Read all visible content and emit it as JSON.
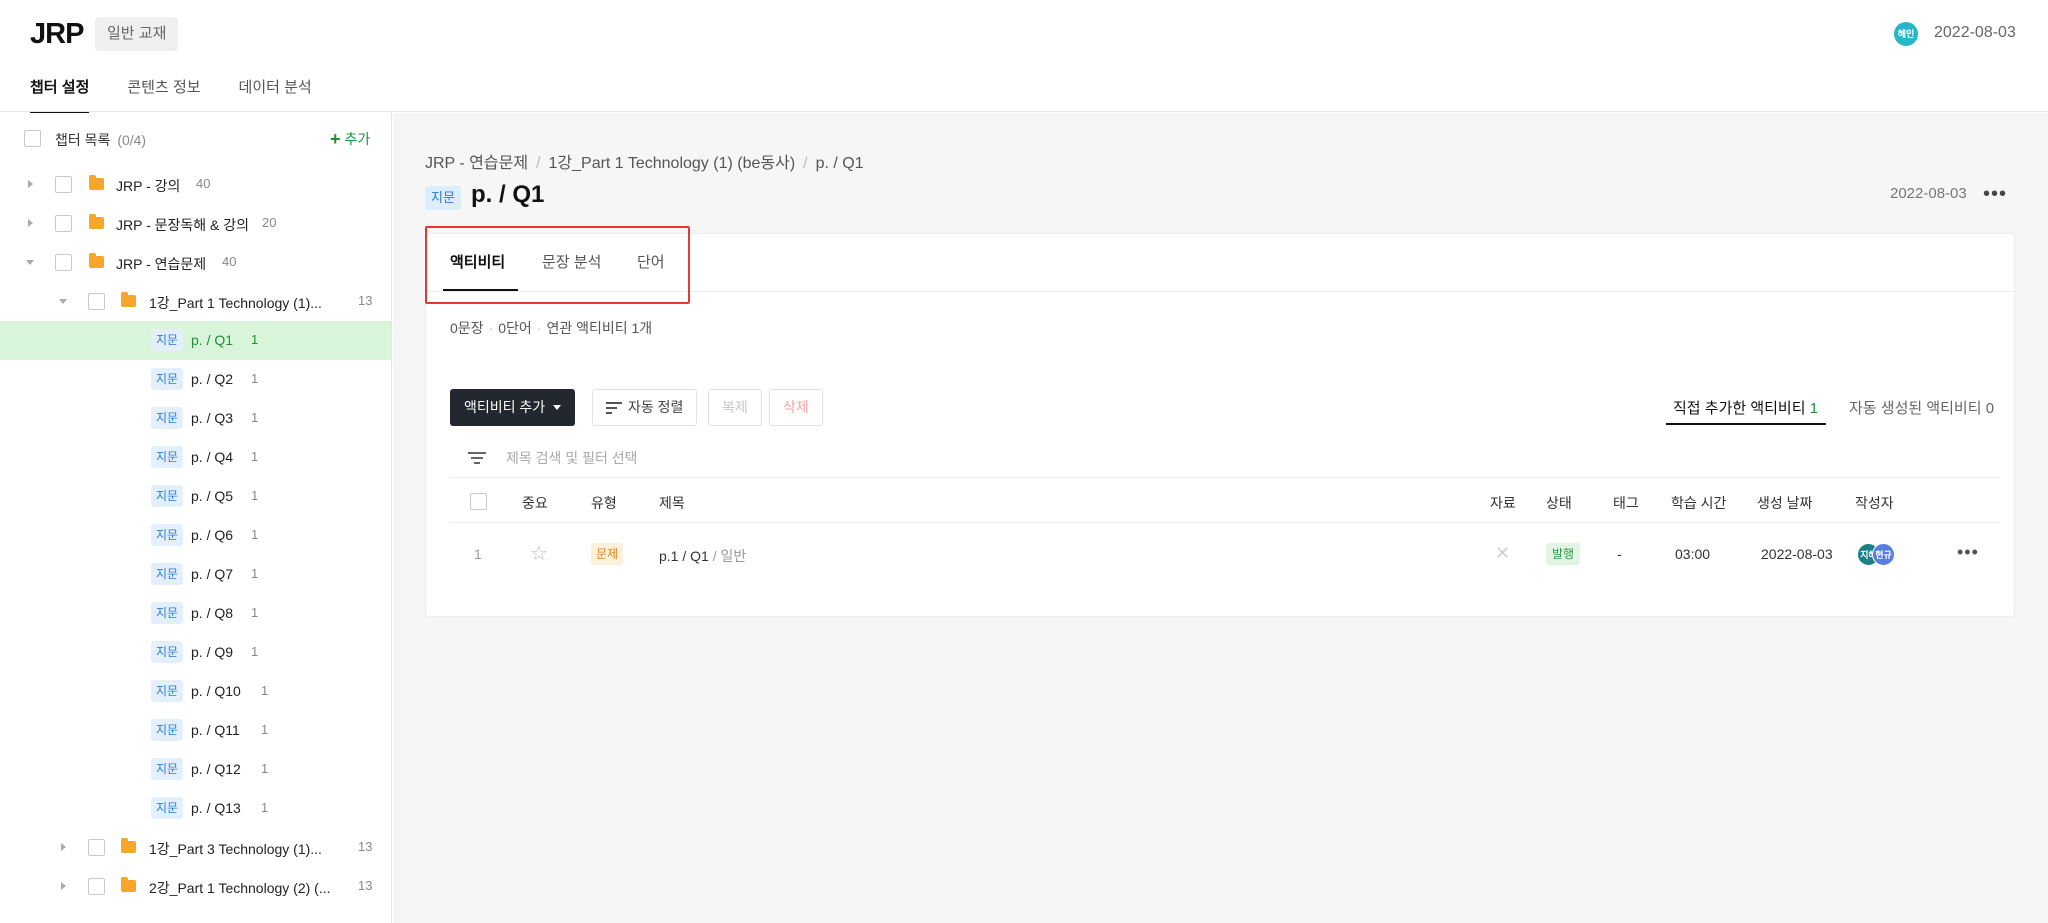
{
  "header": {
    "logo": "JRP",
    "badge": "일반 교재",
    "user_avatar": "혜인",
    "date": "2022-08-03",
    "tabs": [
      {
        "label": "챕터 설정",
        "active": true
      },
      {
        "label": "콘텐츠 정보",
        "active": false
      },
      {
        "label": "데이터 분석",
        "active": false
      }
    ]
  },
  "sidebar": {
    "title": "챕터 목록",
    "count": "(0/4)",
    "add_label": "추가",
    "items": [
      {
        "name": "JRP - 강의",
        "count": "40"
      },
      {
        "name": "JRP - 문장독해 & 강의",
        "count": "20"
      },
      {
        "name": "JRP - 연습문제",
        "count": "40"
      },
      {
        "name": "1강_Part 1 Technology (1)...",
        "count": "13"
      },
      {
        "tag": "지문",
        "name": "p. / Q1",
        "count": "1"
      },
      {
        "tag": "지문",
        "name": "p. / Q2",
        "count": "1"
      },
      {
        "tag": "지문",
        "name": "p. / Q3",
        "count": "1"
      },
      {
        "tag": "지문",
        "name": "p. / Q4",
        "count": "1"
      },
      {
        "tag": "지문",
        "name": "p. / Q5",
        "count": "1"
      },
      {
        "tag": "지문",
        "name": "p. / Q6",
        "count": "1"
      },
      {
        "tag": "지문",
        "name": "p. / Q7",
        "count": "1"
      },
      {
        "tag": "지문",
        "name": "p. / Q8",
        "count": "1"
      },
      {
        "tag": "지문",
        "name": "p. / Q9",
        "count": "1"
      },
      {
        "tag": "지문",
        "name": "p. / Q10",
        "count": "1"
      },
      {
        "tag": "지문",
        "name": "p. / Q11",
        "count": "1"
      },
      {
        "tag": "지문",
        "name": "p. / Q12",
        "count": "1"
      },
      {
        "tag": "지문",
        "name": "p. / Q13",
        "count": "1"
      },
      {
        "name": "1강_Part 3 Technology (1)...",
        "count": "13"
      },
      {
        "name": "2강_Part 1 Technology (2) (...",
        "count": "13"
      }
    ]
  },
  "main": {
    "breadcrumb": [
      "JRP - 연습문제",
      "1강_Part 1 Technology (1) (be동사)",
      "p. / Q1"
    ],
    "page_tag": "지문",
    "page_title": "p. / Q1",
    "page_date": "2022-08-03",
    "inner_tabs": [
      {
        "label": "액티비티",
        "active": true
      },
      {
        "label": "문장 분석",
        "active": false
      },
      {
        "label": "단어",
        "active": false
      }
    ],
    "stats": {
      "sentences": "0문장",
      "words": "0단어",
      "related": "연관 액티비티 1개"
    },
    "toolbar": {
      "add_activity": "액티비티 추가",
      "auto_sort": "자동 정렬",
      "copy": "복제",
      "delete": "삭제"
    },
    "segments": {
      "manual_label": "직접 추가한 액티비티",
      "manual_count": "1",
      "auto_label": "자동 생성된 액티비티",
      "auto_count": "0"
    },
    "filter_placeholder": "제목 검색 및 필터 선택",
    "table": {
      "headers": {
        "important": "중요",
        "type": "유형",
        "title": "제목",
        "material": "자료",
        "status": "상태",
        "tag": "태그",
        "study_time": "학습 시간",
        "created": "생성 날짜",
        "author": "작성자"
      },
      "rows": [
        {
          "no": "1",
          "type": "문제",
          "title": "p.1 / Q1",
          "title_sub": "/ 일반",
          "status": "발행",
          "tag": "-",
          "study_time": "03:00",
          "created": "2022-08-03",
          "authors": [
            "지혜",
            "현규"
          ]
        }
      ]
    }
  },
  "colors": {
    "accent_green": "#1f8f3a",
    "selection_bg": "#d8f5d9",
    "highlight_red": "#e53935",
    "dark_button": "#23272f"
  }
}
